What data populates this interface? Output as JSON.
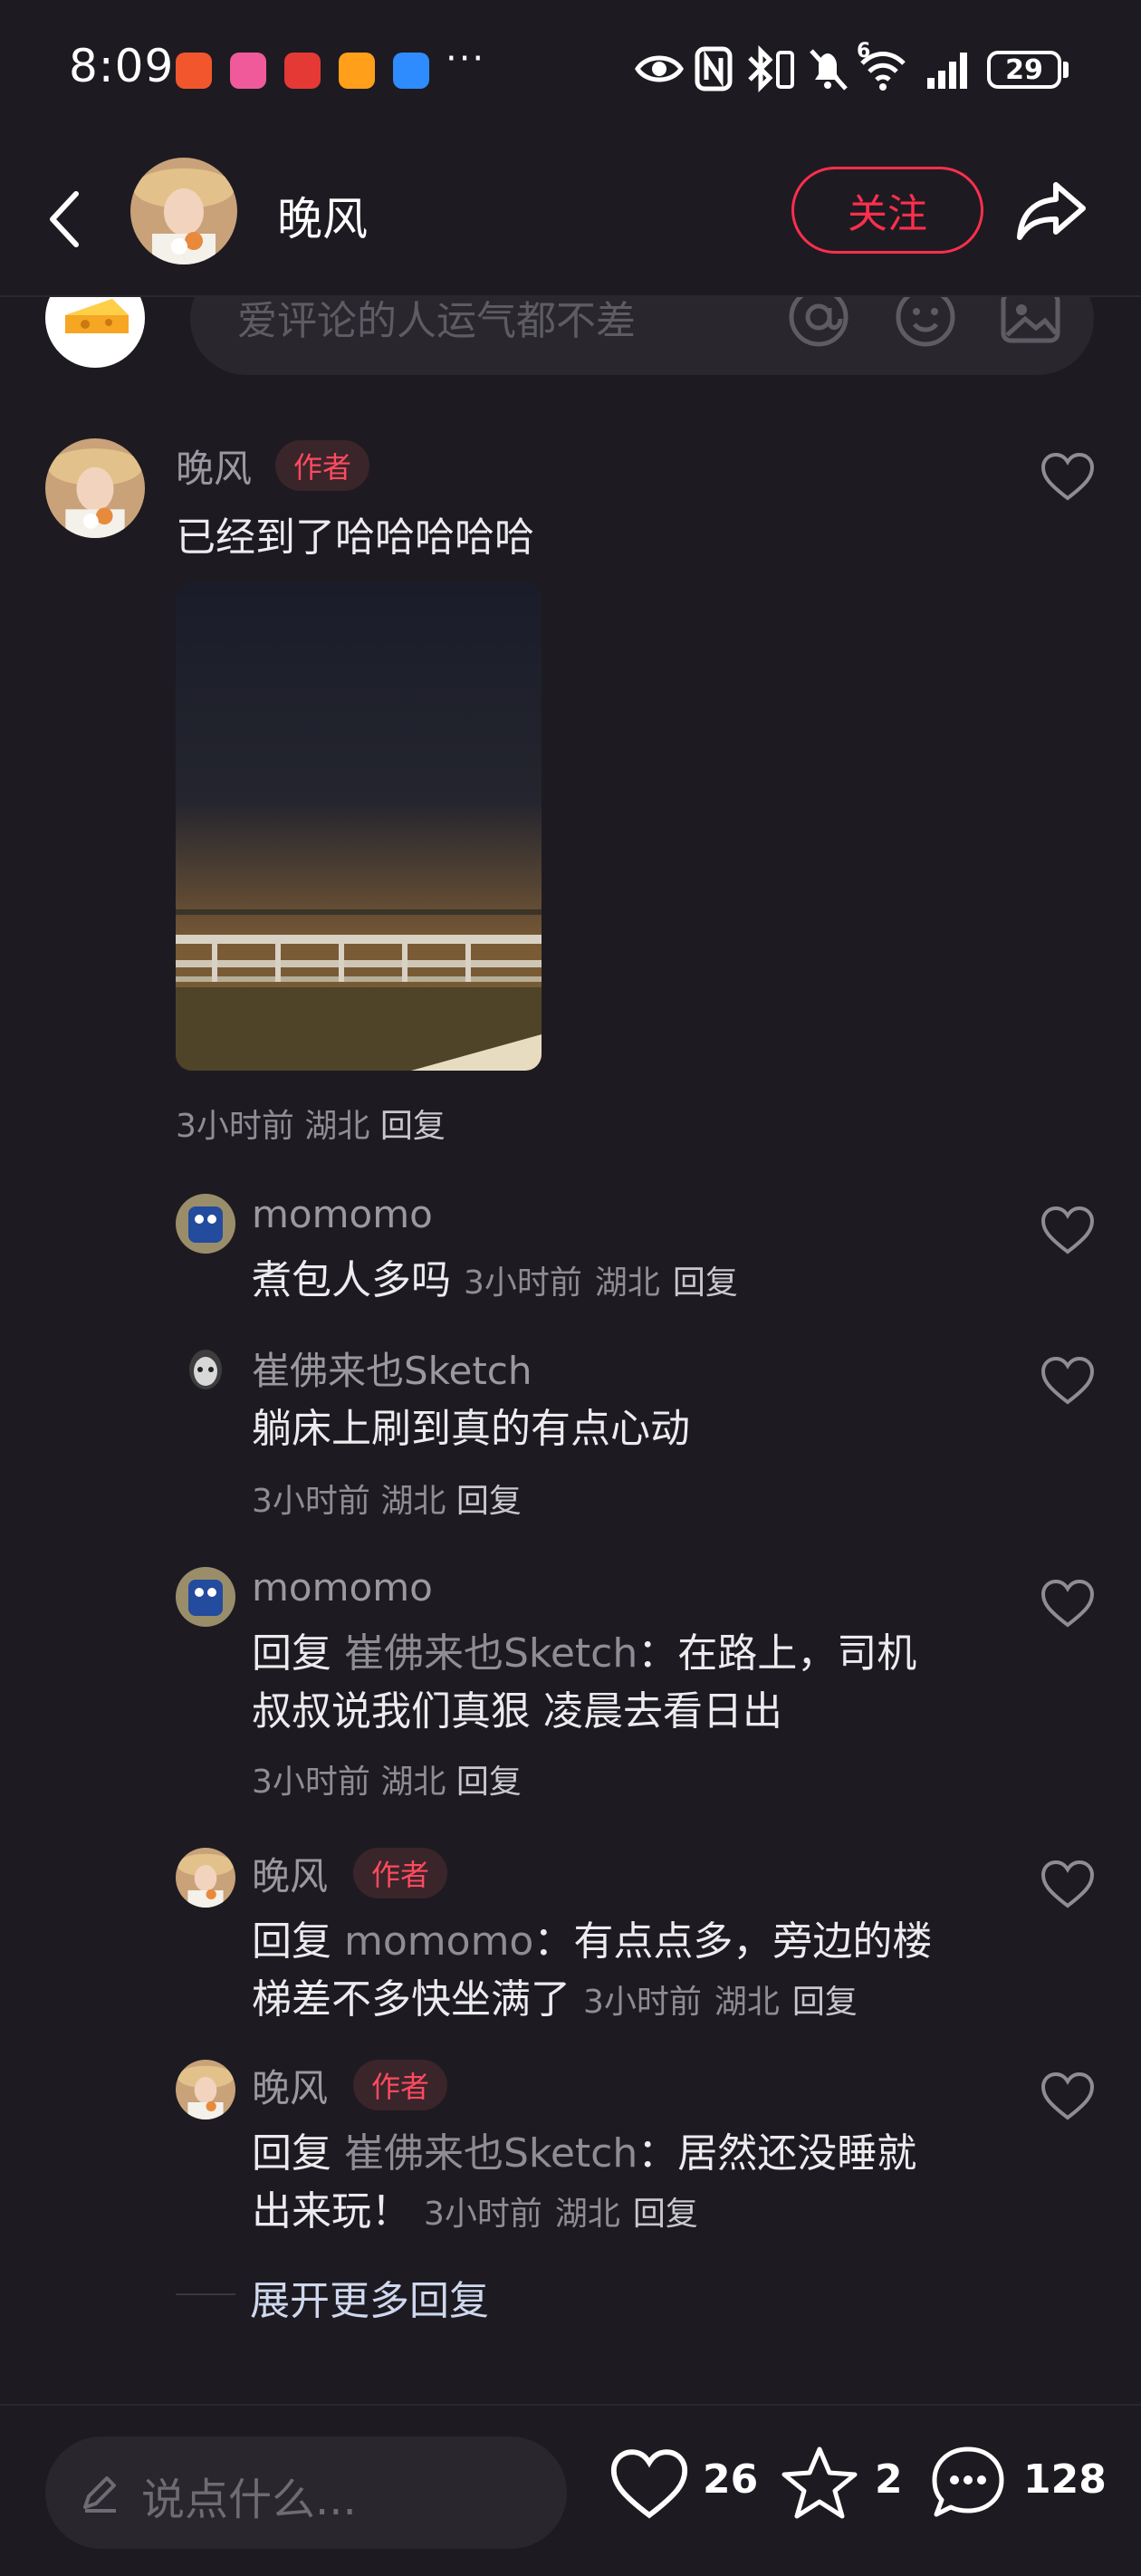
{
  "status_bar": {
    "time": "8:09",
    "network": "6",
    "battery": "29",
    "app_colors": [
      "#f2562d",
      "#f15a9a",
      "#e53935",
      "#ff9f1a",
      "#2f8cff"
    ]
  },
  "header": {
    "title": "晚风",
    "follow_label": "关注"
  },
  "comment_input": {
    "placeholder": "爱评论的人运气都不差"
  },
  "main_comment": {
    "author": "晚风",
    "author_tag": "作者",
    "text": "已经到了哈哈哈哈哈",
    "time": "3小时前",
    "location": "湖北",
    "reply_label": "回复"
  },
  "replies": [
    {
      "author": "momomo",
      "text": "煮包人多吗",
      "time": "3小时前",
      "location": "湖北",
      "reply_label": "回复"
    },
    {
      "author": "崔佛来也Sketch",
      "text": "躺床上刷到真的有点心动",
      "time": "3小时前",
      "location": "湖北",
      "reply_label": "回复"
    },
    {
      "author": "momomo",
      "reply_prefix": "回复",
      "mention": "崔佛来也Sketch",
      "text_line1": "：在路上，司机",
      "text_line2": "叔叔说我们真狠 凌晨去看日出",
      "time": "3小时前",
      "location": "湖北",
      "reply_label": "回复"
    },
    {
      "author": "晚风",
      "author_tag": "作者",
      "reply_prefix": "回复",
      "mention": "momomo",
      "text_line1": "：有点点多，旁边的楼",
      "text_line2": "梯差不多快坐满了",
      "time": "3小时前",
      "location": "湖北",
      "reply_label": "回复"
    },
    {
      "author": "晚风",
      "author_tag": "作者",
      "reply_prefix": "回复",
      "mention": "崔佛来也Sketch",
      "text_line1": "：居然还没睡就",
      "text_line2": "出来玩！",
      "time": "3小时前",
      "location": "湖北",
      "reply_label": "回复"
    }
  ],
  "expand_more": "展开更多回复",
  "bottom_bar": {
    "say_placeholder": "说点什么...",
    "likes": "26",
    "favorites": "2",
    "comments": "128"
  }
}
